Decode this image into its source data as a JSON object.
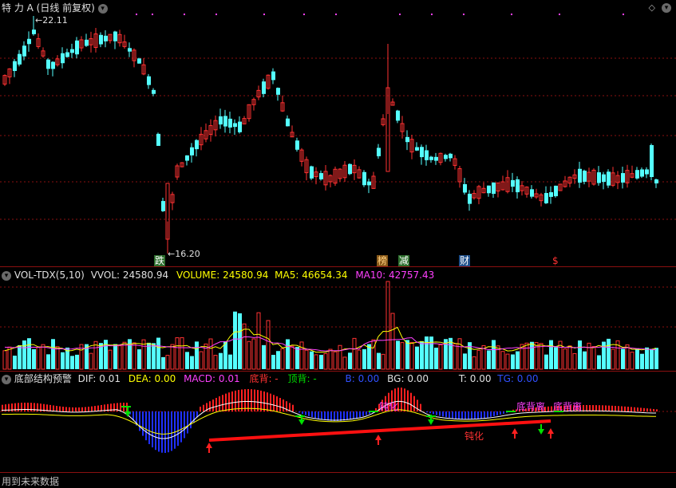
{
  "header": {
    "title": "特 力 A (日线 前复权)",
    "high_label": "22.11",
    "low_label": "16.20"
  },
  "markers": {
    "die": "跌",
    "bang": "榜",
    "jian": "减",
    "cai": "财",
    "dollar": "$"
  },
  "vol": {
    "name": "VOL-TDX(5,10)",
    "vvol": "VVOL: 24580.94",
    "volume": "VOLUME: 24580.94",
    "ma5": "MA5: 46654.34",
    "ma10": "MA10: 42757.43",
    "colors": {
      "volume": "#ffff00",
      "ma5": "#ffff00",
      "ma10": "#ff40ff"
    }
  },
  "indicator": {
    "name": "底部结构预警",
    "dif": "DIF: 0.01",
    "dea": "DEA: 0.00",
    "macd": "MACD: 0.01",
    "dibei": "底背: -",
    "dingbei": "顶背: -",
    "b": "B: 0.00",
    "bg": "BG: 0.00",
    "t": "T: 0.00",
    "tg": "TG: 0.00",
    "annotations": {
      "dhh": "钝化",
      "dibeili1": "底背离",
      "dibeili2": "底背离",
      "dunhua": "钝化"
    }
  },
  "footer": "用到未来数据",
  "colors": {
    "up": "#ff3232",
    "down": "#54ffff",
    "bg": "#000000",
    "grid": "#8a1010"
  }
}
